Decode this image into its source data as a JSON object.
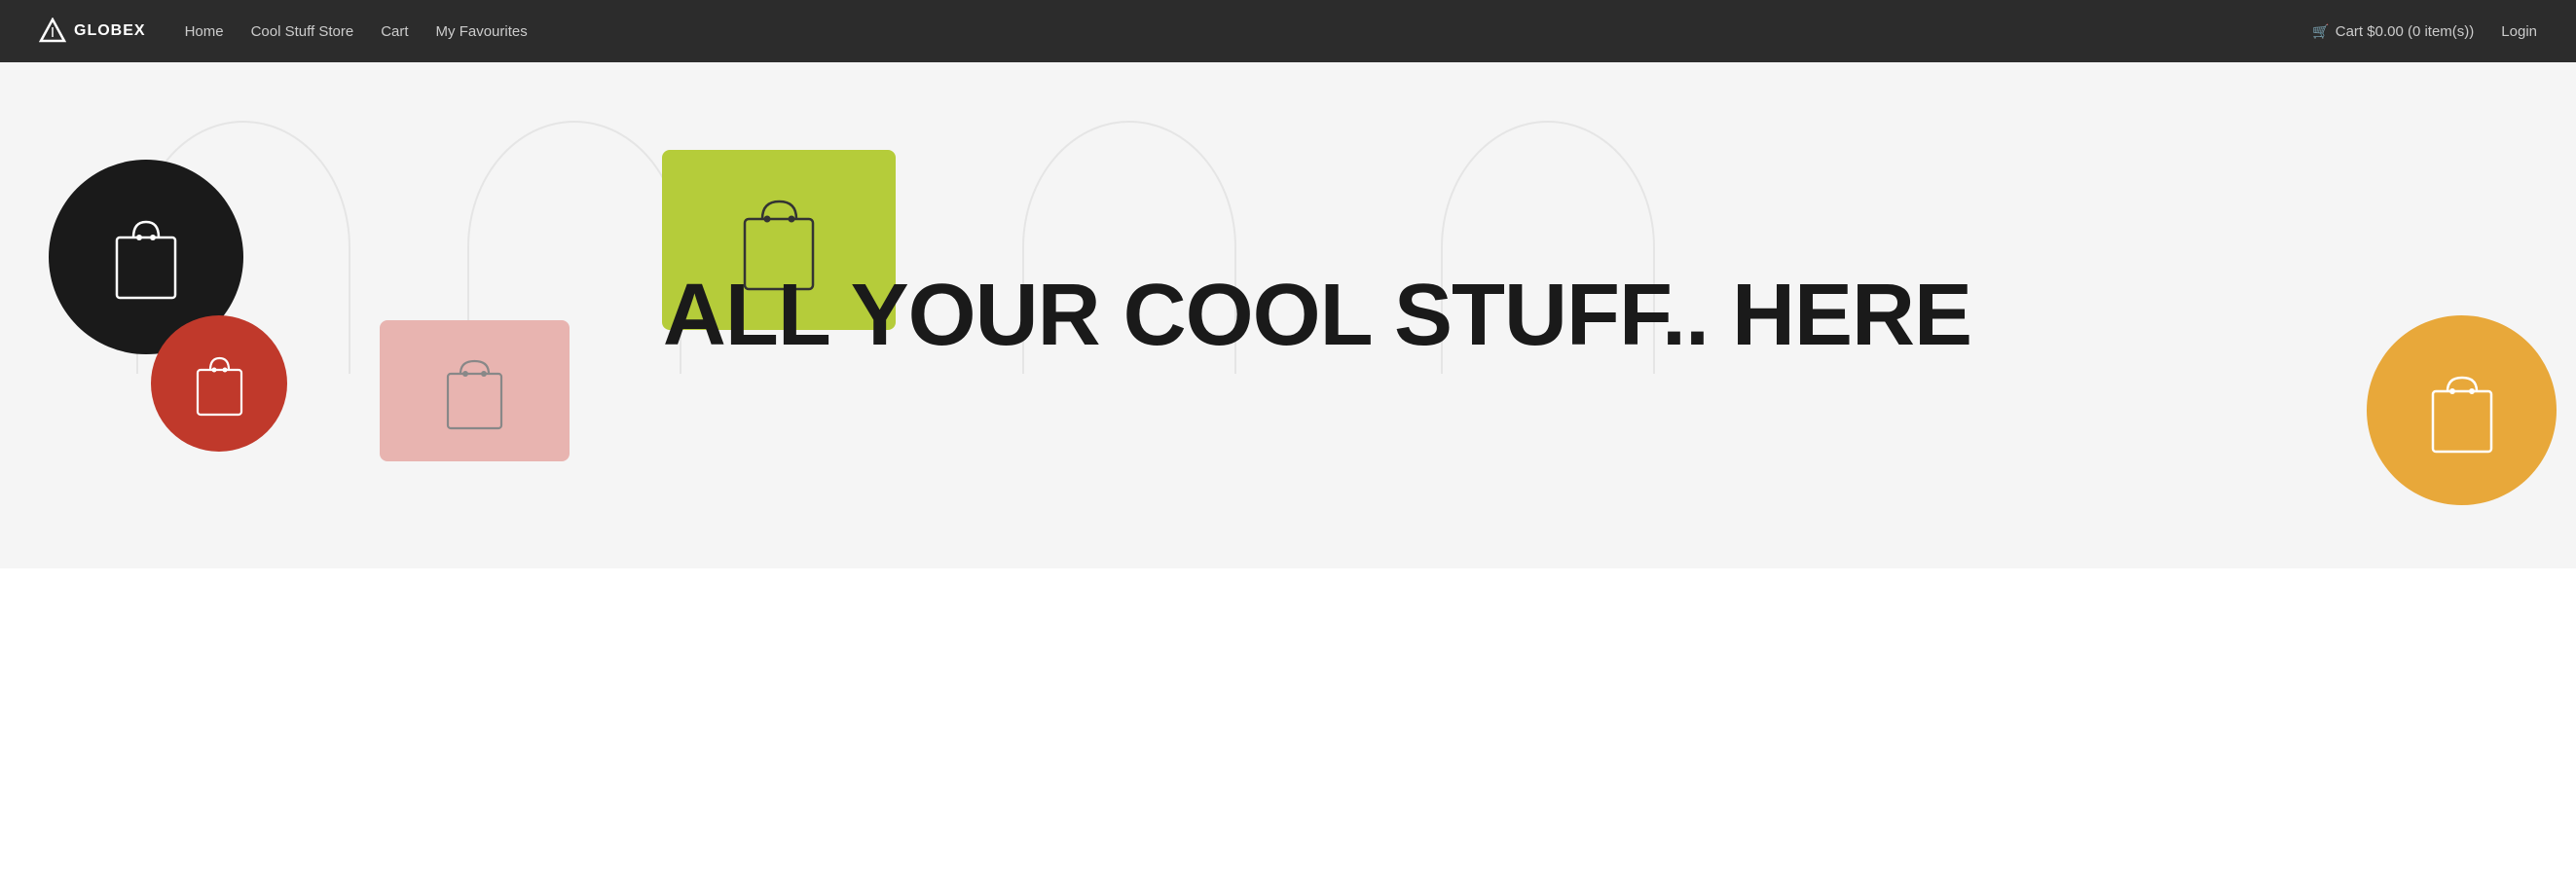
{
  "brand": {
    "name": "GLOBEX",
    "icon": "triangle-icon"
  },
  "nav": {
    "links": [
      {
        "label": "Home",
        "href": "#"
      },
      {
        "label": "Cool Stuff Store",
        "href": "#"
      },
      {
        "label": "Cart",
        "href": "#"
      },
      {
        "label": "My Favourites",
        "href": "#"
      }
    ]
  },
  "cart": {
    "label": "Cart",
    "amount": "$0.00",
    "items": "0 item(s)",
    "full_text": "Cart $0.00 (0 item(s))"
  },
  "auth": {
    "login_label": "Login"
  },
  "hero": {
    "headline_line1": "ALL YOUR COOL STUFF.. HERE"
  }
}
